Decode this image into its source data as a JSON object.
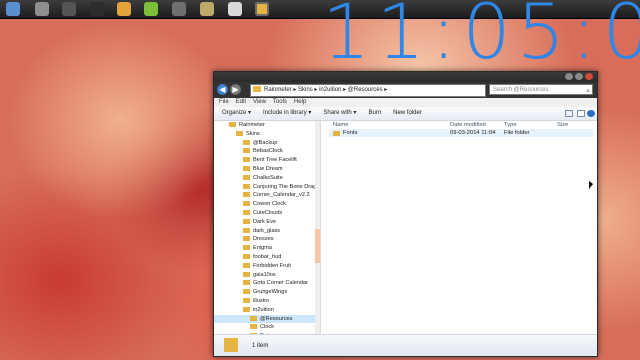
{
  "desktop": {
    "clock_text": "11:05:0"
  },
  "taskbar": {
    "icons": [
      {
        "name": "rainmeter-icon",
        "color": "#5a8fd0"
      },
      {
        "name": "media-player-icon",
        "color": "#8f8f8f"
      },
      {
        "name": "steam-icon",
        "color": "#555555"
      },
      {
        "name": "terminal-icon",
        "color": "#2d2d2d"
      },
      {
        "name": "chrome-icon",
        "color": "#e2a23b"
      },
      {
        "name": "utorrent-icon",
        "color": "#7cbf3a"
      },
      {
        "name": "app-icon",
        "color": "#6f6f6f"
      },
      {
        "name": "editor-icon",
        "color": "#bfa96a"
      },
      {
        "name": "paint-icon",
        "color": "#d9d9d9"
      },
      {
        "name": "explorer-icon",
        "color": "#e6b443"
      }
    ]
  },
  "window": {
    "address_parts": [
      "Rainmeter",
      "Skins",
      "in2uition",
      "@Resources"
    ],
    "search_placeholder": "Search @Resources",
    "menu": [
      "File",
      "Edit",
      "View",
      "Tools",
      "Help"
    ],
    "toolbar": [
      "Organize ▾",
      "Include in library ▾",
      "Share with ▾",
      "Burn",
      "New folder"
    ],
    "nav_items": [
      {
        "label": "Rainmeter",
        "indent": 1
      },
      {
        "label": "Skins",
        "indent": 2
      },
      {
        "label": "@Backup",
        "indent": 3
      },
      {
        "label": "BebasClock",
        "indent": 3
      },
      {
        "label": "Bent Tree Facelift",
        "indent": 3
      },
      {
        "label": "Blue Dream",
        "indent": 3
      },
      {
        "label": "ChalksSuite",
        "indent": 3
      },
      {
        "label": "Conjuring The Bone Drago",
        "indent": 3
      },
      {
        "label": "Corner_Calendar_v2.2",
        "indent": 3
      },
      {
        "label": "Cowon Clock",
        "indent": 3
      },
      {
        "label": "CuteClouds",
        "indent": 3
      },
      {
        "label": "Dark Eve",
        "indent": 3
      },
      {
        "label": "dark_glass",
        "indent": 3
      },
      {
        "label": "Dresses",
        "indent": 3
      },
      {
        "label": "Enigma",
        "indent": 3
      },
      {
        "label": "foobar_hud",
        "indent": 3
      },
      {
        "label": "Forbidden Fruit",
        "indent": 3
      },
      {
        "label": "gaia10os",
        "indent": 3
      },
      {
        "label": "Gota Corner Calendar",
        "indent": 3
      },
      {
        "label": "GrungeWings",
        "indent": 3
      },
      {
        "label": "illustro",
        "indent": 3
      },
      {
        "label": "in2uition",
        "indent": 3
      },
      {
        "label": "@Resources",
        "indent": 4,
        "selected": true
      },
      {
        "label": "Clock",
        "indent": 4
      },
      {
        "label": "Date",
        "indent": 4
      }
    ],
    "columns": [
      "Name",
      "Date modified",
      "Type",
      "Size"
    ],
    "files": [
      {
        "name": "Fonts",
        "date": "09-03-2014 11:04",
        "type": "File folder",
        "size": ""
      }
    ],
    "status_text": "1 item"
  }
}
